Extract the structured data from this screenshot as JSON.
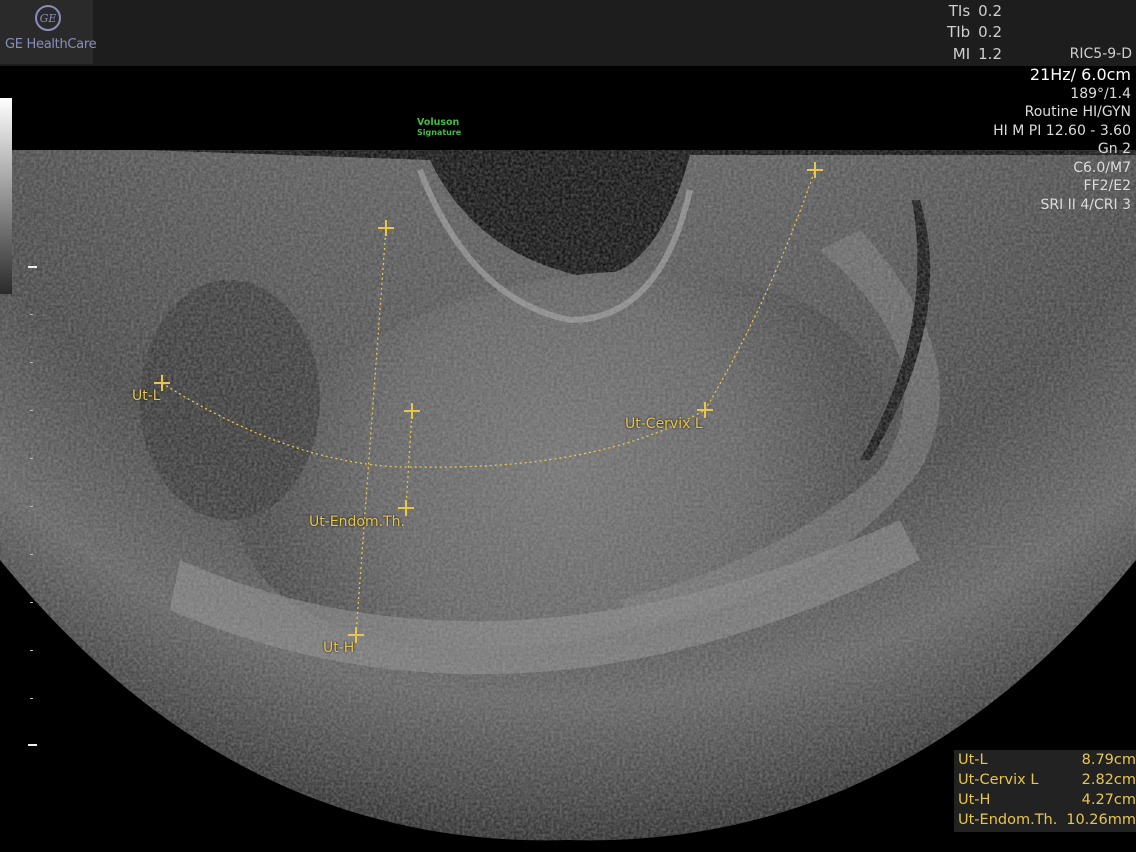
{
  "brand": {
    "logo_glyph": "GE",
    "name": "GE HealthCare",
    "product_line1": "Voluson",
    "product_line2": "Signature"
  },
  "indices": [
    {
      "label": "TIs",
      "value": "0.2"
    },
    {
      "label": "TIb",
      "value": "0.2"
    },
    {
      "label": "MI",
      "value": "1.2"
    }
  ],
  "probe": "RIC5-9-D",
  "params": {
    "frame_depth": "21Hz/ 6.0cm",
    "angle": "189°/1.4",
    "preset": "Routine HI/GYN",
    "harmonics": "HI M PI 12.60 - 3.60",
    "gain": "Gn  2",
    "map": "C6.0/M7",
    "ff": "FF2/E2",
    "sri": "SRI II 4/CRI 3"
  },
  "markers": {
    "ut_l": "Ut-L",
    "ut_cervix_l": "Ut-Cervix L",
    "ut_endom": "Ut-Endom.Th.",
    "ut_h": "Ut-H"
  },
  "results": [
    {
      "name": "Ut-L",
      "value": "8.79cm"
    },
    {
      "name": "Ut-Cervix L",
      "value": "2.82cm"
    },
    {
      "name": "Ut-H",
      "value": "4.27cm"
    },
    {
      "name": "Ut-Endom.Th.",
      "value": "10.26mm"
    }
  ],
  "colors": {
    "measure": "#e8c64a",
    "brand_green": "#3fbf3f",
    "logo": "#8a8dbd"
  }
}
